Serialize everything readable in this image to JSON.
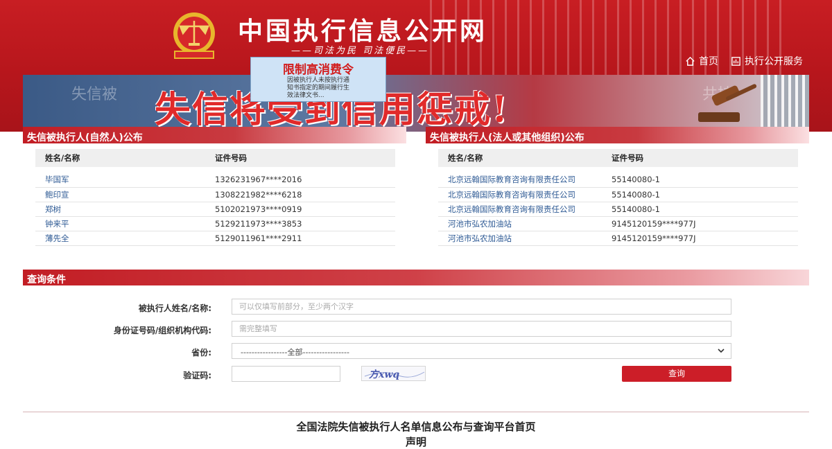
{
  "header": {
    "site_title": "中国执行信息公开网",
    "slogan": "——司法为民  司法便民——",
    "nav": [
      {
        "label": "首页",
        "icon": "home-icon"
      },
      {
        "label": "执行公开服务",
        "icon": "service-icon"
      }
    ],
    "banner_text": "失信将受到信用惩戒!",
    "banner_bg_left": "失信被",
    "banner_bg_right": "共持",
    "popup": {
      "title": "限制高消费令",
      "lines": [
        "因被执行人未按执行通",
        "知书指定的期间履行生",
        "效法律文书..."
      ]
    }
  },
  "natural_panel": {
    "title": "失信被执行人(自然人)公布",
    "columns": [
      "姓名/名称",
      "证件号码"
    ],
    "rows": [
      [
        "毕国军",
        "1326231967****2016"
      ],
      [
        "鲍印宣",
        "1308221982****6218"
      ],
      [
        "郑树",
        "5102021973****0919"
      ],
      [
        "钟来平",
        "5129211973****3853"
      ],
      [
        "薄先全",
        "5129011961****2911"
      ]
    ]
  },
  "legal_panel": {
    "title": "失信被执行人(法人或其他组织)公布",
    "columns": [
      "姓名/名称",
      "证件号码"
    ],
    "rows": [
      [
        "北京远翰国际教育咨询有限责任公司",
        "55140080-1"
      ],
      [
        "北京远翰国际教育咨询有限责任公司",
        "55140080-1"
      ],
      [
        "北京远翰国际教育咨询有限责任公司",
        "55140080-1"
      ],
      [
        "河池市弘农加油站",
        "9145120159****977J"
      ],
      [
        "河池市弘农加油站",
        "9145120159****977J"
      ]
    ]
  },
  "query": {
    "title": "查询条件",
    "name_label": "被执行人姓名/名称:",
    "name_placeholder": "可以仅填写前部分，至少两个汉字",
    "id_label": "身份证号码/组织机构代码:",
    "id_placeholder": "需完整填写",
    "province_label": "省份:",
    "province_value": "-----------------全部-----------------",
    "captcha_label": "验证码:",
    "captcha_text": "方xwq",
    "search_label": "查询"
  },
  "footer": {
    "title": "全国法院失信被执行人名单信息公布与查询平台首页",
    "subtitle": "声明"
  },
  "colors": {
    "brand_red": "#c81e23",
    "button_red": "#cc1e28",
    "link_blue": "#2f5b95"
  }
}
